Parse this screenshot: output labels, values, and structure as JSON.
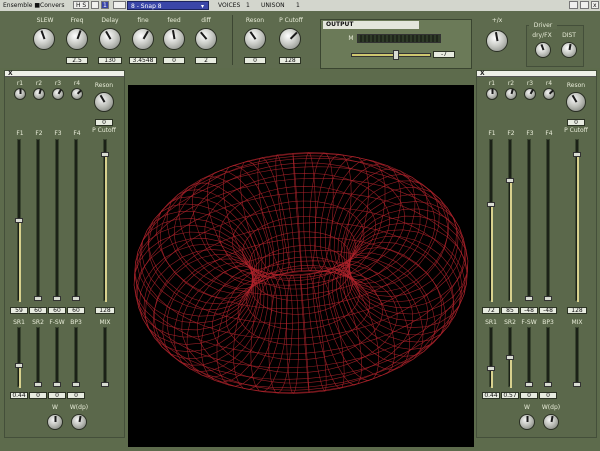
{
  "topbar": {
    "ensemble_name": "Ensemble ■Convers",
    "field_a": "H S",
    "field_b": "1",
    "snap": "8 - Snap 8",
    "voices_label": "VOICES",
    "voices_value": "1",
    "unison_label": "UNISON",
    "unison_value": "1",
    "close": "x"
  },
  "controls": {
    "slew": {
      "label": "SLEW"
    },
    "freq": {
      "label": "Freq",
      "value": "2.5"
    },
    "delay": {
      "label": "Delay",
      "value": "130"
    },
    "fine": {
      "label": "fine",
      "value": "3.4548"
    },
    "feed": {
      "label": "feed",
      "value": "0"
    },
    "diff": {
      "label": "diff",
      "value": "2"
    },
    "reson": {
      "label": "Reson",
      "value": "0"
    },
    "pcutoff": {
      "label": "P Cutoff",
      "value": "128"
    },
    "plusx": {
      "label": "+/x"
    }
  },
  "output": {
    "title": "OUTPUT",
    "m_label": "M",
    "value": "-7"
  },
  "driver": {
    "title": "Driver",
    "dryfx": "dry/FX",
    "dist": "DIST"
  },
  "left": {
    "header": "X",
    "mini_labels": [
      "r1",
      "r2",
      "r3",
      "r4"
    ],
    "reson_label": "Reson",
    "reson_value": "0",
    "pcutoff_label": "P Cutoff",
    "fader_labels": [
      "F1",
      "F2",
      "F3",
      "F4"
    ],
    "fader_levels": [
      0.5,
      0.0,
      0.0,
      0.0
    ],
    "fader_values": [
      "59",
      "60",
      "60",
      "60"
    ],
    "cutoff_level": 0.92,
    "cutoff_value": "128",
    "bottom_labels": [
      "SR1",
      "SR2",
      "F-SW",
      "BP3",
      "MIX"
    ],
    "bottom_levels": [
      0.35,
      0.0,
      0.0,
      0.0,
      0.0
    ],
    "bottom_values": [
      "0.44",
      "0",
      "0",
      "0",
      ""
    ],
    "w_label": "W",
    "wdpl_label": "W(dp)"
  },
  "right": {
    "header": "X",
    "mini_labels": [
      "r1",
      "r2",
      "r3",
      "r4"
    ],
    "reson_label": "Reson",
    "reson_value": "0",
    "pcutoff_label": "P Cutoff",
    "fader_labels": [
      "F1",
      "F2",
      "F3",
      "F4"
    ],
    "fader_levels": [
      0.6,
      0.75,
      0.0,
      0.0
    ],
    "fader_values": [
      "72",
      "85",
      "-48",
      "-48"
    ],
    "cutoff_level": 0.92,
    "cutoff_value": "128",
    "bottom_labels": [
      "SR1",
      "SR2",
      "F-SW",
      "BP3",
      "MIX"
    ],
    "bottom_levels": [
      0.3,
      0.5,
      0.0,
      0.0,
      0.0
    ],
    "bottom_values": [
      "0.44",
      "0.57",
      "0",
      "0",
      ""
    ],
    "w_label": "W",
    "wdpl_label": "W(dp)"
  },
  "colors": {
    "panel": "#5e6b4e",
    "display_bg": "#000000",
    "mesh": "#b0232b",
    "value_box": "#e7ebe0",
    "snap_bg": "#3a46a8"
  }
}
